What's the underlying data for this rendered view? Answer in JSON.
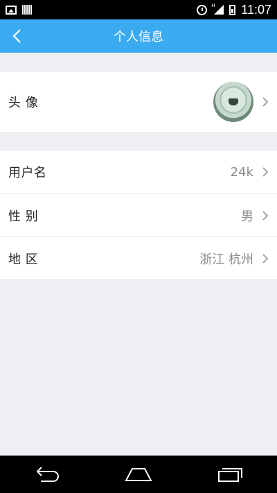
{
  "status_bar": {
    "time": "11:07",
    "network_label": "H",
    "icons": [
      "image-icon",
      "barcode-icon",
      "alarm-icon",
      "signal-icon",
      "battery-icon"
    ]
  },
  "header": {
    "title": "个人信息",
    "back_icon": "chevron-left-icon"
  },
  "profile": {
    "avatar_label": "头 像",
    "rows": [
      {
        "label": "用户名",
        "value": "24k"
      },
      {
        "label": "性 别",
        "value": "男"
      },
      {
        "label": "地 区",
        "value": "浙江 杭州"
      }
    ]
  },
  "navigation": {
    "buttons": [
      "back-icon",
      "home-icon",
      "recent-apps-icon"
    ]
  },
  "colors": {
    "accent": "#3aaaf1",
    "background": "#eff0f3",
    "value_text": "#8a8a8a"
  }
}
